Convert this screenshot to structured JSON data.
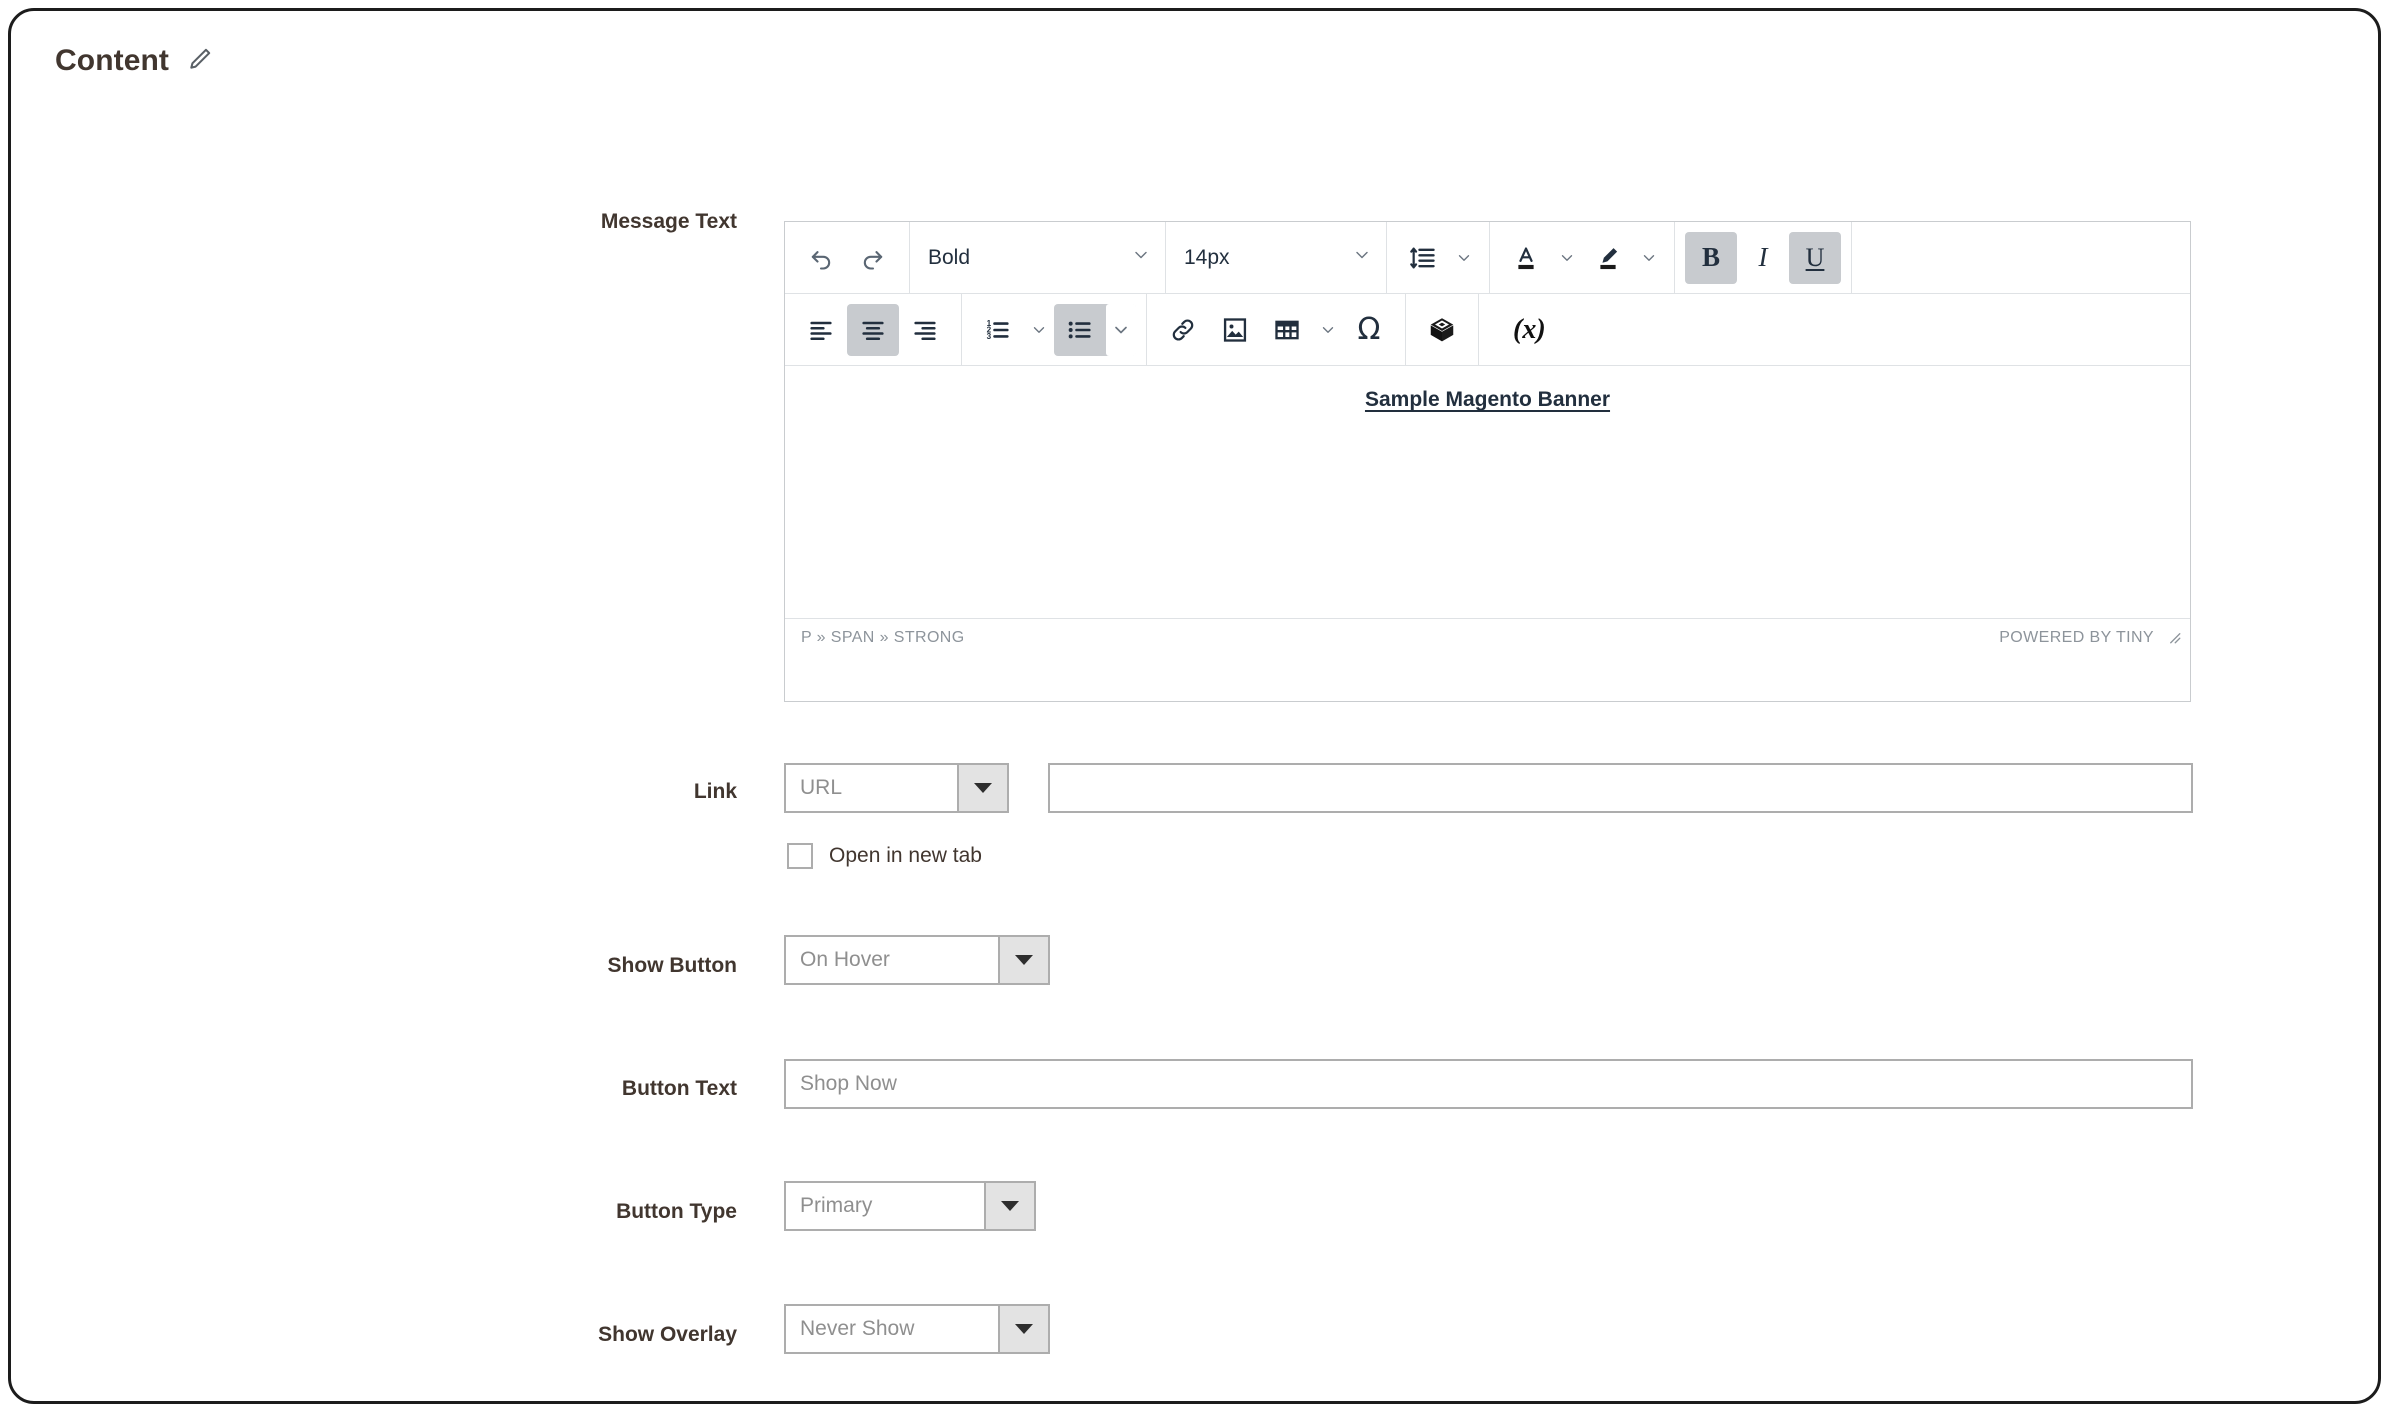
{
  "section": {
    "title": "Content",
    "edit_icon": "pencil-icon"
  },
  "fields": {
    "message_text": {
      "label": "Message Text"
    },
    "link": {
      "label": "Link",
      "select_value": "URL",
      "url_value": "",
      "url_placeholder": ""
    },
    "open_new_tab": {
      "label": "Open in new tab",
      "checked": false
    },
    "show_button": {
      "label": "Show Button",
      "value": "On Hover"
    },
    "button_text": {
      "label": "Button Text",
      "value": "Shop Now"
    },
    "button_type": {
      "label": "Button Type",
      "value": "Primary"
    },
    "show_overlay": {
      "label": "Show Overlay",
      "value": "Never Show"
    }
  },
  "editor": {
    "toolbar_row1": {
      "undo": "undo-icon",
      "redo": "redo-icon",
      "format_value": "Bold",
      "fontsize_value": "14px",
      "lineheight": "line-height-icon",
      "text_color": "text-color-icon",
      "highlight_color": "highlight-color-icon",
      "bold": "B",
      "italic": "I",
      "underline": "U",
      "bold_active": true,
      "italic_active": false,
      "underline_active": true
    },
    "toolbar_row2": {
      "align_left": "align-left-icon",
      "align_center": "align-center-icon",
      "align_right": "align-right-icon",
      "align_center_active": true,
      "numbered_list": "numbered-list-icon",
      "bullet_list": "bullet-list-icon",
      "bullet_list_active": true,
      "link": "link-icon",
      "image": "image-icon",
      "table": "table-icon",
      "special_char": "Ω",
      "widget": "magento-widget-icon",
      "variable": "(x)"
    },
    "content_html": "Sample Magento Banner",
    "status": {
      "element_path": "P » SPAN » STRONG",
      "branding": "POWERED BY TINY",
      "resize_handle": "resize-grip-icon"
    }
  },
  "colors": {
    "text": "#41362f",
    "border_dark": "#1c1c1c",
    "input_border": "#adadad",
    "toolbar_border": "#dfe2e5",
    "active_bg": "#c8cbcf",
    "icon": "#222f3e",
    "muted": "#8f8f8f"
  }
}
